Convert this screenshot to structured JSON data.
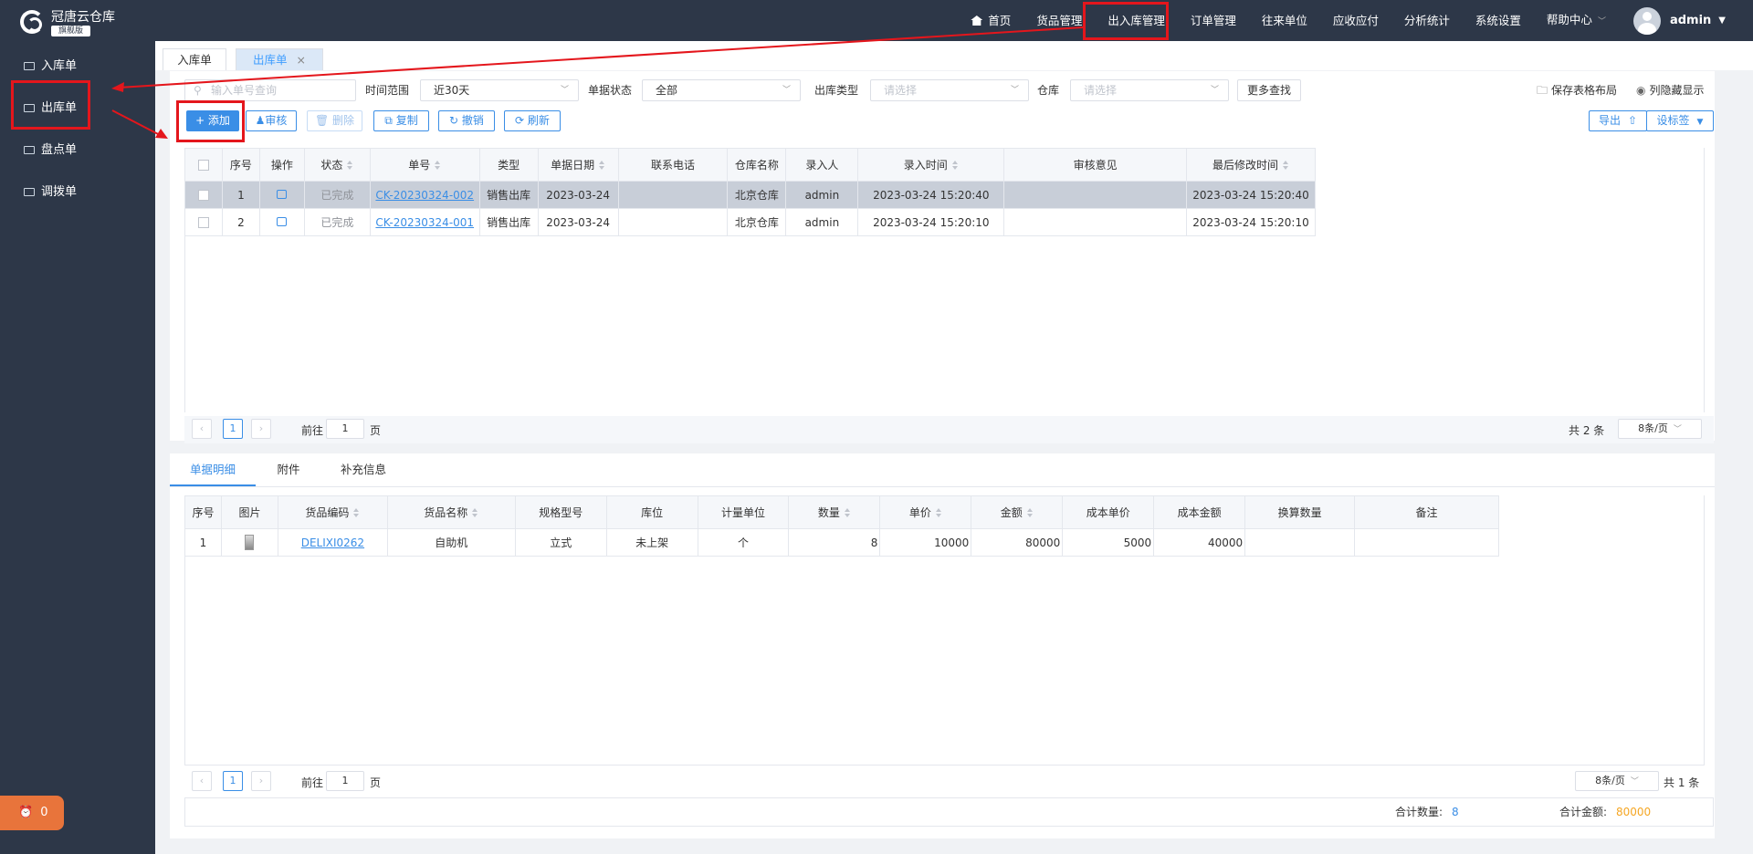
{
  "app": {
    "name": "冠唐云仓库",
    "edition": "旗舰版"
  },
  "sidebar": {
    "items": [
      {
        "label": "入库单",
        "icon": "folder-in-icon"
      },
      {
        "label": "出库单",
        "icon": "folder-icon"
      },
      {
        "label": "盘点单",
        "icon": "folder-icon"
      },
      {
        "label": "调拨单",
        "icon": "folder-icon"
      }
    ],
    "alarm_count": "0"
  },
  "topnav": {
    "items": [
      "首页",
      "货品管理",
      "出入库管理",
      "订单管理",
      "往来单位",
      "应收应付",
      "分析统计",
      "系统设置",
      "帮助中心"
    ],
    "active": "出入库管理",
    "user": "admin"
  },
  "pagetabs": [
    {
      "label": "入库单"
    },
    {
      "label": "出库单",
      "close": "×"
    }
  ],
  "filters": {
    "search_placeholder": "输入单号查询",
    "range_label": "时间范围",
    "range_value": "近30天",
    "status_label": "单据状态",
    "status_value": "全部",
    "type_label": "出库类型",
    "type_placeholder": "请选择",
    "warehouse_label": "仓库",
    "warehouse_placeholder": "请选择",
    "more": "更多查找",
    "save_layout": "保存表格布局",
    "hide_cols": "列隐藏显示"
  },
  "toolbar": {
    "add": "+ 添加",
    "audit": "审核",
    "delete": "删除",
    "copy": "复制",
    "revoke": "撤销",
    "refresh": "刷新",
    "export": "导出",
    "set_tag": "设标签"
  },
  "orders": {
    "columns": [
      "序号",
      "操作",
      "状态",
      "单号",
      "类型",
      "单据日期",
      "联系电话",
      "仓库名称",
      "录入人",
      "录入时间",
      "审核意见",
      "最后修改时间"
    ],
    "rows": [
      {
        "no": "1",
        "status": "已完成",
        "code": "CK-20230324-002",
        "type": "销售出库",
        "date": "2023-03-24",
        "phone": "",
        "warehouse": "北京仓库",
        "user": "admin",
        "created": "2023-03-24 15:20:40",
        "opinion": "",
        "modified": "2023-03-24 15:20:40"
      },
      {
        "no": "2",
        "status": "已完成",
        "code": "CK-20230324-001",
        "type": "销售出库",
        "date": "2023-03-24",
        "phone": "",
        "warehouse": "北京仓库",
        "user": "admin",
        "created": "2023-03-24 15:20:10",
        "opinion": "",
        "modified": "2023-03-24 15:20:10"
      }
    ],
    "pager": {
      "page": "1",
      "goto": "前往",
      "page_unit": "页",
      "total": "共 2 条",
      "size": "8条/页"
    }
  },
  "detail": {
    "tabs": [
      "单据明细",
      "附件",
      "补充信息"
    ],
    "columns": [
      "序号",
      "图片",
      "货品编码",
      "货品名称",
      "规格型号",
      "库位",
      "计量单位",
      "数量",
      "单价",
      "金额",
      "成本单价",
      "成本金额",
      "换算数量",
      "备注"
    ],
    "rows": [
      {
        "no": "1",
        "code": "DELIXI0262",
        "name": "自助机",
        "spec": "立式",
        "loc": "未上架",
        "unit": "个",
        "qty": "8",
        "price": "10000",
        "amount": "80000",
        "cost_price": "5000",
        "cost_amount": "40000",
        "conv": "",
        "note": ""
      }
    ],
    "pager": {
      "page": "1",
      "goto": "前往",
      "page_unit": "页",
      "size": "8条/页",
      "total": "共 1 条"
    },
    "summary": {
      "qty_label": "合计数量:",
      "qty": "8",
      "amount_label": "合计金额:",
      "amount": "80000"
    }
  },
  "colors": {
    "sidebar": "#2d3748",
    "accent": "#3a8ee6",
    "highlight": "#e4161c",
    "amount": "#f5a623"
  }
}
